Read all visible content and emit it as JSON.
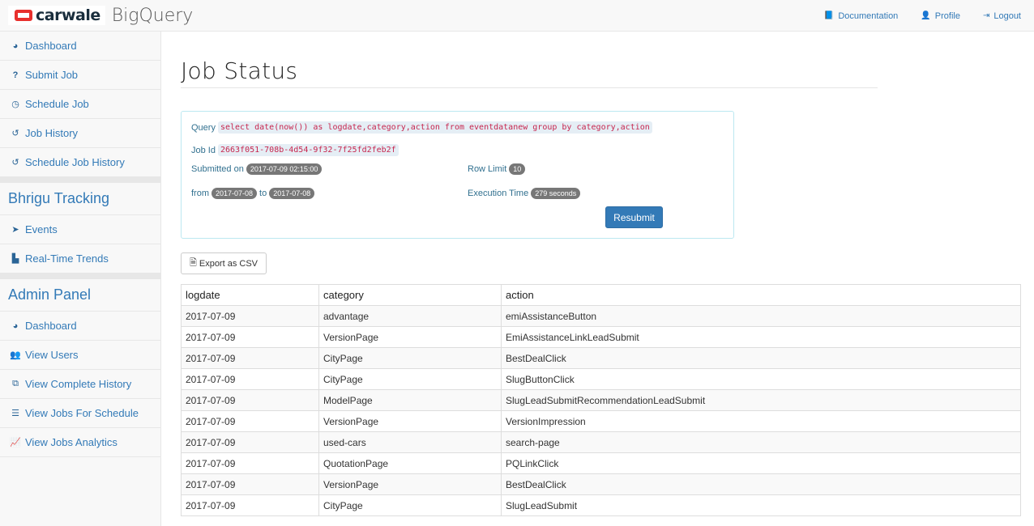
{
  "brand": {
    "logo_text": "carwale",
    "app_name": "BigQuery",
    "logo_color": "#e8302d"
  },
  "topnav": [
    {
      "icon": "book-icon",
      "glyph": "📘",
      "label": "Documentation"
    },
    {
      "icon": "user-icon",
      "glyph": "👤",
      "label": "Profile"
    },
    {
      "icon": "logout-icon",
      "glyph": "⇥",
      "label": "Logout"
    }
  ],
  "sidebar": {
    "items": [
      {
        "icon": "dashboard-icon",
        "glyph": "◕",
        "label": "Dashboard"
      },
      {
        "icon": "question-icon",
        "glyph": "?",
        "label": "Submit Job"
      },
      {
        "icon": "clock-icon",
        "glyph": "◷",
        "label": "Schedule Job"
      },
      {
        "icon": "history-icon",
        "glyph": "↺",
        "label": "Job History"
      },
      {
        "icon": "history-icon",
        "glyph": "↺",
        "label": "Schedule Job History"
      }
    ],
    "bhrigu_header": "Bhrigu Tracking",
    "bhrigu_items": [
      {
        "icon": "cursor-icon",
        "glyph": "➤",
        "label": "Events"
      },
      {
        "icon": "bar-chart-icon",
        "glyph": "▙",
        "label": "Real-Time Trends"
      }
    ],
    "admin_header": "Admin Panel",
    "admin_items": [
      {
        "icon": "dashboard-icon",
        "glyph": "◕",
        "label": "Dashboard"
      },
      {
        "icon": "users-icon",
        "glyph": "👥",
        "label": "View Users"
      },
      {
        "icon": "copy-icon",
        "glyph": "⧉",
        "label": "View Complete History"
      },
      {
        "icon": "tasks-icon",
        "glyph": "☰",
        "label": "View Jobs For Schedule"
      },
      {
        "icon": "line-chart-icon",
        "glyph": "📈",
        "label": "View Jobs Analytics"
      }
    ]
  },
  "page": {
    "title": "Job Status"
  },
  "job": {
    "query_label": "Query",
    "query": "select date(now()) as logdate,category,action from eventdatanew group by category,action",
    "job_id_label": "Job Id",
    "job_id": "2663f051-708b-4d54-9f32-7f25fd2feb2f",
    "submitted_label": "Submitted on",
    "submitted_on": "2017-07-09 02:15:00",
    "row_limit_label": "Row Limit",
    "row_limit": "10",
    "from_label": "from",
    "from": "2017-07-08",
    "to_label": "to",
    "to": "2017-07-08",
    "exec_label": "Execution Time",
    "exec_time": "279 seconds",
    "resubmit_label": "Resubmit"
  },
  "export": {
    "label": "Export as CSV",
    "icon": "file-excel-icon"
  },
  "results": {
    "columns": [
      "logdate",
      "category",
      "action"
    ],
    "rows": [
      [
        "2017-07-09",
        "advantage",
        "emiAssistanceButton"
      ],
      [
        "2017-07-09",
        "VersionPage",
        "EmiAssistanceLinkLeadSubmit"
      ],
      [
        "2017-07-09",
        "CityPage",
        "BestDealClick"
      ],
      [
        "2017-07-09",
        "CityPage",
        "SlugButtonClick"
      ],
      [
        "2017-07-09",
        "ModelPage",
        "SlugLeadSubmitRecommendationLeadSubmit"
      ],
      [
        "2017-07-09",
        "VersionPage",
        "VersionImpression"
      ],
      [
        "2017-07-09",
        "used-cars",
        "search-page"
      ],
      [
        "2017-07-09",
        "QuotationPage",
        "PQLinkClick"
      ],
      [
        "2017-07-09",
        "VersionPage",
        "BestDealClick"
      ],
      [
        "2017-07-09",
        "CityPage",
        "SlugLeadSubmit"
      ]
    ]
  }
}
